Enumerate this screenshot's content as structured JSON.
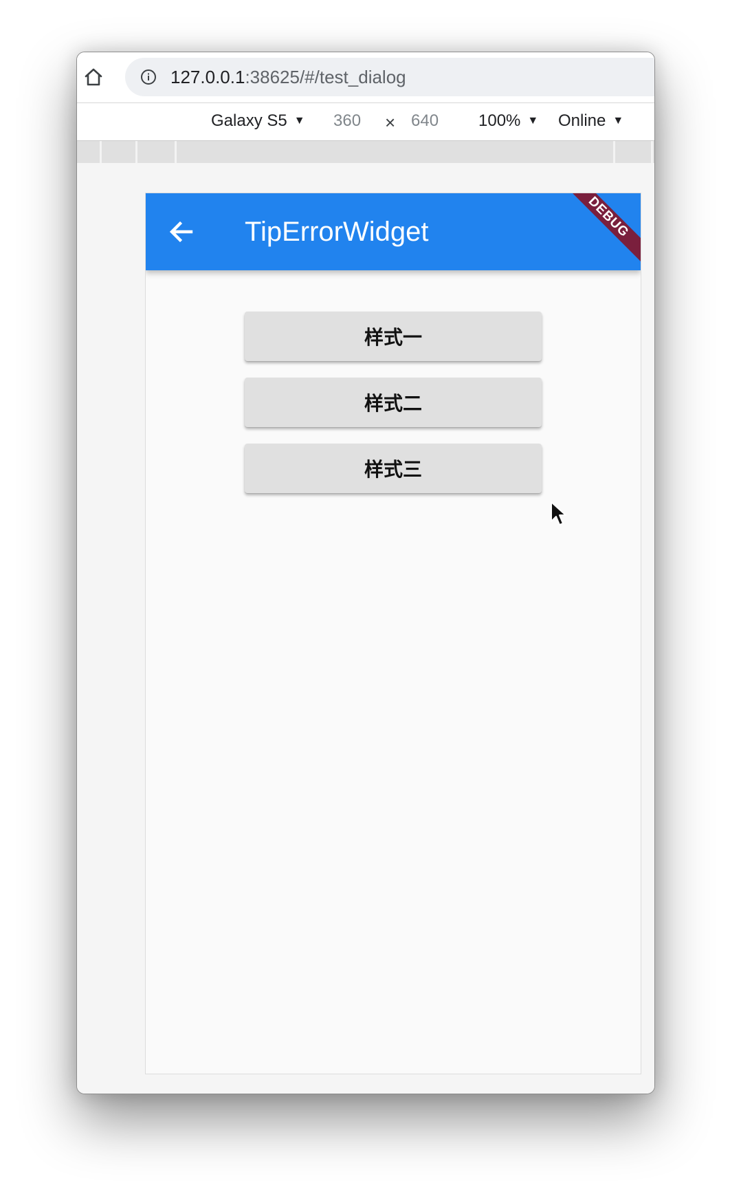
{
  "browser": {
    "url_host": "127.0.0.1",
    "url_rest": ":38625/#/test_dialog"
  },
  "device_toolbar": {
    "device": "Galaxy S5",
    "width": "360",
    "times": "×",
    "height": "640",
    "zoom": "100%",
    "network": "Online"
  },
  "app": {
    "title": "TipErrorWidget",
    "debug_banner": "DEBUG",
    "buttons": [
      "样式一",
      "样式二",
      "样式三"
    ]
  },
  "colors": {
    "appbar": "#2183ee",
    "debug_banner": "#7a1f3d",
    "button": "#e0e0e0"
  },
  "icons": {
    "home": "home-icon",
    "info": "info-icon",
    "back": "arrow-back-icon",
    "cursor": "mouse-pointer-icon"
  }
}
